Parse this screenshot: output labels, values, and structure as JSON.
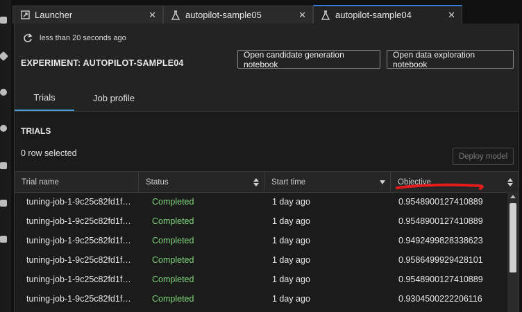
{
  "tabs": [
    {
      "label": "Launcher",
      "icon": "launcher-icon"
    },
    {
      "label": "autopilot-sample05",
      "icon": "flask-icon"
    },
    {
      "label": "autopilot-sample04",
      "icon": "flask-icon",
      "active": true
    }
  ],
  "header": {
    "refresh_text": "less than 20 seconds ago",
    "experiment_title": "EXPERIMENT: AUTOPILOT-SAMPLE04",
    "btn_candidate": "Open candidate generation notebook",
    "btn_exploration": "Open data exploration notebook"
  },
  "subtabs": [
    {
      "label": "Trials",
      "active": true
    },
    {
      "label": "Job profile",
      "active": false
    }
  ],
  "trials": {
    "title": "TRIALS",
    "selection": "0 row selected",
    "deploy_label": "Deploy model"
  },
  "table": {
    "columns": [
      "Trial name",
      "Status",
      "Start time",
      "Objective"
    ],
    "rows": [
      {
        "name": "tuning-job-1-9c25c82fd1f…",
        "status": "Completed",
        "start": "1 day ago",
        "objective": "0.9548900127410889"
      },
      {
        "name": "tuning-job-1-9c25c82fd1f…",
        "status": "Completed",
        "start": "1 day ago",
        "objective": "0.9548900127410889"
      },
      {
        "name": "tuning-job-1-9c25c82fd1f…",
        "status": "Completed",
        "start": "1 day ago",
        "objective": "0.9492499828338623"
      },
      {
        "name": "tuning-job-1-9c25c82fd1f…",
        "status": "Completed",
        "start": "1 day ago",
        "objective": "0.9586499929428101"
      },
      {
        "name": "tuning-job-1-9c25c82fd1f…",
        "status": "Completed",
        "start": "1 day ago",
        "objective": "0.9548900127410889"
      },
      {
        "name": "tuning-job-1-9c25c82fd1f…",
        "status": "Completed",
        "start": "1 day ago",
        "objective": "0.9304500222206116"
      }
    ]
  },
  "colors": {
    "accent": "#4a9fd0",
    "status_completed": "#7ed67a",
    "annotation": "#e21b1b"
  }
}
